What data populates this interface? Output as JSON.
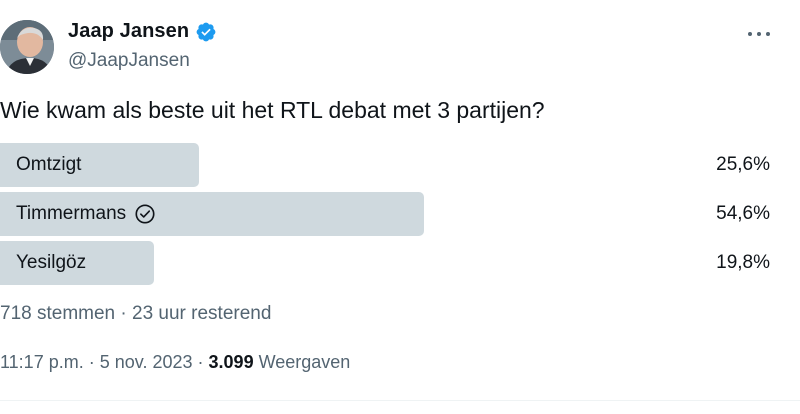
{
  "author": {
    "display_name": "Jaap Jansen",
    "handle": "@JaapJansen",
    "verified": true
  },
  "tweet": {
    "question": "Wie kwam als beste uit het RTL debat met 3 partijen?"
  },
  "poll": {
    "options": [
      {
        "label": "Omtzigt",
        "percent_text": "25,6%",
        "percent": 25.6,
        "winner": false
      },
      {
        "label": "Timmermans",
        "percent_text": "54,6%",
        "percent": 54.6,
        "winner": true
      },
      {
        "label": "Yesilgöz",
        "percent_text": "19,8%",
        "percent": 19.8,
        "winner": false
      }
    ],
    "votes_text": "718 stemmen",
    "separator": "·",
    "remaining_text": "23 uur resterend"
  },
  "meta": {
    "time": "11:17 p.m.",
    "date": "5 nov. 2023",
    "views_count": "3.099",
    "views_label": "Weergaven"
  },
  "colors": {
    "bar": "#cfd9de",
    "verified": "#1d9bf0",
    "secondary_text": "#536471"
  },
  "icons": {
    "verified": "verified-badge-icon",
    "winner": "check-circle-icon",
    "more": "more-dots-icon"
  }
}
